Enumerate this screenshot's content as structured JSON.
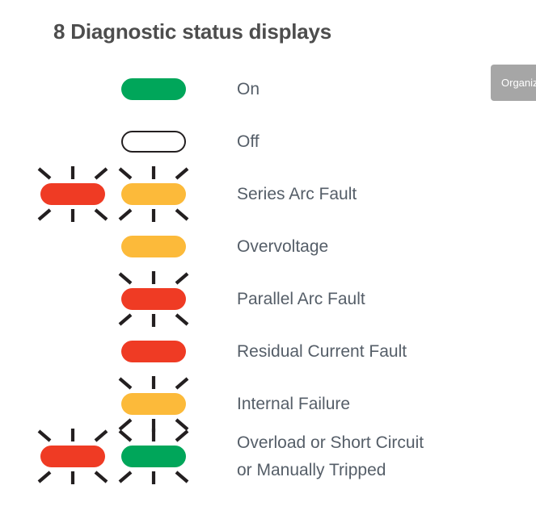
{
  "title": "8 Diagnostic status displays",
  "colors": {
    "green": "#00a65a",
    "red": "#ef3b24",
    "amber": "#fcba3a",
    "outline": "#231f20",
    "label_text": "#555e68",
    "title_text": "#4d4d4d",
    "tooltip_bg": "#a6a6a6"
  },
  "tooltip": {
    "label": "Organize"
  },
  "legend": {
    "rows": [
      {
        "label": "On",
        "label_line2": "",
        "leds": [
          {
            "column": 2,
            "state": "solid",
            "color": "green",
            "blinking": false,
            "icon": "led-green-on"
          }
        ]
      },
      {
        "label": "Off",
        "label_line2": "",
        "leds": [
          {
            "column": 2,
            "state": "outline",
            "color": "white",
            "blinking": false,
            "icon": "led-off-outline"
          }
        ]
      },
      {
        "label": "Series Arc Fault",
        "label_line2": "",
        "leds": [
          {
            "column": 1,
            "state": "solid",
            "color": "red",
            "blinking": true,
            "icon": "led-red-blinking"
          },
          {
            "column": 2,
            "state": "solid",
            "color": "amber",
            "blinking": true,
            "icon": "led-amber-blinking"
          }
        ]
      },
      {
        "label": "Overvoltage",
        "label_line2": "",
        "leds": [
          {
            "column": 2,
            "state": "solid",
            "color": "amber",
            "blinking": false,
            "icon": "led-amber-on"
          }
        ]
      },
      {
        "label": "Parallel Arc Fault",
        "label_line2": "",
        "leds": [
          {
            "column": 2,
            "state": "solid",
            "color": "red",
            "blinking": true,
            "icon": "led-red-blinking"
          }
        ]
      },
      {
        "label": "Residual Current Fault",
        "label_line2": "",
        "leds": [
          {
            "column": 2,
            "state": "solid",
            "color": "red",
            "blinking": false,
            "icon": "led-red-on"
          }
        ]
      },
      {
        "label": "Internal Failure",
        "label_line2": "",
        "leds": [
          {
            "column": 2,
            "state": "solid",
            "color": "amber",
            "blinking": true,
            "icon": "led-amber-blinking"
          }
        ]
      },
      {
        "label": "Overload or Short Circuit",
        "label_line2": "or Manually Tripped",
        "leds": [
          {
            "column": 1,
            "state": "solid",
            "color": "red",
            "blinking": true,
            "icon": "led-red-blinking"
          },
          {
            "column": 2,
            "state": "solid",
            "color": "green",
            "blinking": true,
            "icon": "led-green-blinking"
          }
        ]
      }
    ]
  }
}
